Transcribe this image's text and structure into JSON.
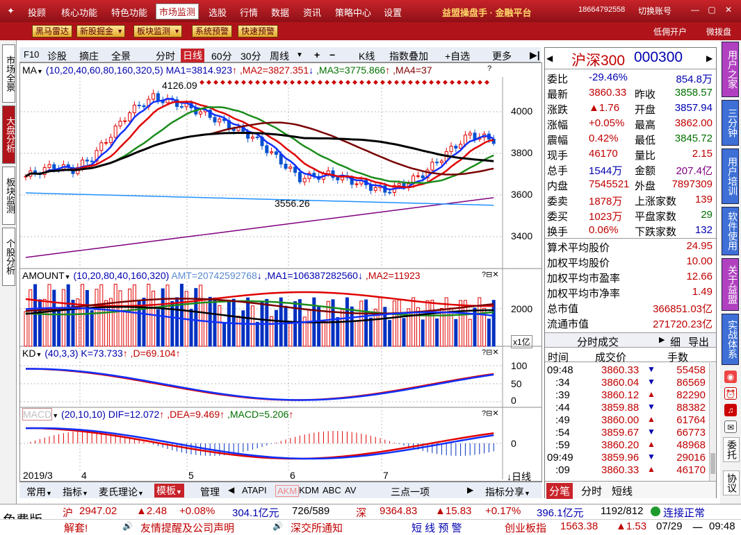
{
  "menu": {
    "items": [
      "投顾",
      "核心功能",
      "特色功能",
      "市场监测",
      "选股",
      "行情",
      "数据",
      "资讯",
      "策略中心",
      "设置"
    ],
    "active": "市场监测",
    "brand": "益盟操盘手 · 金融平台",
    "phone": "18664792558",
    "switch_account": "切换账号"
  },
  "toolbar2": {
    "buttons": [
      "黑马雷达",
      "新股掘金",
      "板块监测",
      "系统预警",
      "快速预警"
    ],
    "right": [
      "低佣开户",
      "微拨盘"
    ]
  },
  "left_rail": [
    "市场全景",
    "大盘分析",
    "板块监测",
    "个股分析"
  ],
  "chart_toolbar": {
    "items": [
      "F10",
      "诊股",
      "摘庄",
      "全景",
      "分时",
      "日线",
      "60分",
      "30分",
      "周线",
      "+",
      "−",
      "K线",
      "指数叠加",
      "+自选",
      "更多"
    ],
    "active": "日线"
  },
  "panels": {
    "ma": {
      "label": "MA",
      "params": "(10,20,40,60,80,160,320,5)",
      "ma1": "MA1=3814.923",
      "ma2": ",MA2=3827.351",
      "ma3": ",MA3=3775.866",
      "ma4": ",MA4=37"
    },
    "amount": {
      "label": "AMOUNT",
      "params": "(10,20,80,40,160,320)",
      "amt": "AMT=20742592768",
      "ma1": ",MA1=106387282560",
      "ma2": ",MA2=11923"
    },
    "kd": {
      "label": "KD",
      "params": "(40,3,3)",
      "k": "K=73.733",
      "d": ",D=69.104"
    },
    "macd": {
      "label": "MACD",
      "params": "(20,10,10)",
      "dif": "DIF=12.072",
      "dea": ",DEA=9.469",
      "macd": ",MACD=5.206"
    }
  },
  "chart_data": {
    "type": "line",
    "title": "",
    "price_high_label": "4126.09",
    "price_low_label": "3556.26",
    "y_ticks": [
      "4000",
      "3800",
      "3600",
      "3400"
    ],
    "amount_ticks": [
      "2000"
    ],
    "amount_unit": "x1亿",
    "kd_ticks": [
      "100",
      "50",
      "0"
    ],
    "macd_ticks": [
      "0"
    ],
    "x_labels": [
      "2019/3",
      "4",
      "5",
      "6",
      "7"
    ],
    "x_period": "日线"
  },
  "bottom_tabs": [
    "常用",
    "指标",
    "麦氏理论",
    "模板",
    "管理",
    "ATAPI",
    "AKM",
    "KDM",
    "ABC",
    "AV",
    "三点一项",
    "指标分享"
  ],
  "bottom_active": "模板",
  "quote": {
    "name": "沪深300",
    "code": "000300",
    "rows": [
      [
        "委比",
        "-29.46%",
        "",
        "854.8万"
      ],
      [
        "最新",
        "3860.33",
        "昨收",
        "3858.57"
      ],
      [
        "涨跌",
        "▲1.76",
        "开盘",
        "3857.94"
      ],
      [
        "涨幅",
        "+0.05%",
        "最高",
        "3862.00"
      ],
      [
        "震幅",
        "0.42%",
        "最低",
        "3845.72"
      ],
      [
        "现手",
        "46170",
        "量比",
        "2.15"
      ],
      [
        "总手",
        "1544万",
        "金额",
        "207.4亿"
      ],
      [
        "内盘",
        "7545521",
        "外盘",
        "7897309"
      ],
      [
        "委卖",
        "1878万",
        "上涨家数",
        "139"
      ],
      [
        "委买",
        "1023万",
        "平盘家数",
        "29"
      ],
      [
        "换手",
        "0.06%",
        "下跌家数",
        "132"
      ]
    ],
    "stats": [
      [
        "算术平均股价",
        "24.95"
      ],
      [
        "加权平均股价",
        "10.00"
      ],
      [
        "加权平均市盈率",
        "12.66"
      ],
      [
        "加权平均市净率",
        "1.49"
      ],
      [
        "总市值",
        "366851.03亿"
      ],
      [
        "流通市值",
        "271720.23亿"
      ]
    ],
    "ticks_title": "分时成交",
    "ticks_detail": "细",
    "ticks_export": "导出",
    "ticks_headers": [
      "时间",
      "成交价",
      "手数"
    ],
    "ticks": [
      [
        "09:48",
        "3860.33",
        "▼",
        "55458"
      ],
      [
        ":34",
        "3860.04",
        "▼",
        "86569"
      ],
      [
        ":39",
        "3860.12",
        "▲",
        "82290"
      ],
      [
        ":44",
        "3859.88",
        "▼",
        "88382"
      ],
      [
        ":49",
        "3860.00",
        "▲",
        "61764"
      ],
      [
        ":54",
        "3859.67",
        "▼",
        "66773"
      ],
      [
        ":59",
        "3860.20",
        "▲",
        "48968"
      ],
      [
        "09:49",
        "3859.96",
        "▼",
        "29016"
      ],
      [
        ":09",
        "3860.33",
        "▲",
        "46170"
      ]
    ],
    "bottom_tabs": [
      "分笔",
      "分时",
      "短线"
    ]
  },
  "right_tabs": [
    "用户之家",
    "三分钟",
    "用户培训",
    "软件使用",
    "关于益盟",
    "实战体系"
  ],
  "right_small": [
    "委托",
    "协议"
  ],
  "status1": {
    "free": "免费版",
    "sh": "沪",
    "sh_val": "2947.02",
    "sh_chg": "▲2.48",
    "sh_pct": "+0.08%",
    "sh_amt": "304.1亿元",
    "sh_ratio": "726/589",
    "sz": "深",
    "sz_val": "9364.83",
    "sz_chg": "▲15.83",
    "sz_pct": "+0.17%",
    "sz_amt": "396.1亿元",
    "sz_ratio": "1192/812",
    "conn": "连接正常"
  },
  "status2": {
    "left": "解套!",
    "notice1": "友情提醒及公司声明",
    "notice2": "深交所通知",
    "alert": "短 线 预 警",
    "cyb": "创业板指",
    "cyb_val": "1563.38",
    "cyb_chg": "▲1.53",
    "date": "07/29",
    "weekday": "一",
    "time": "09:48"
  }
}
